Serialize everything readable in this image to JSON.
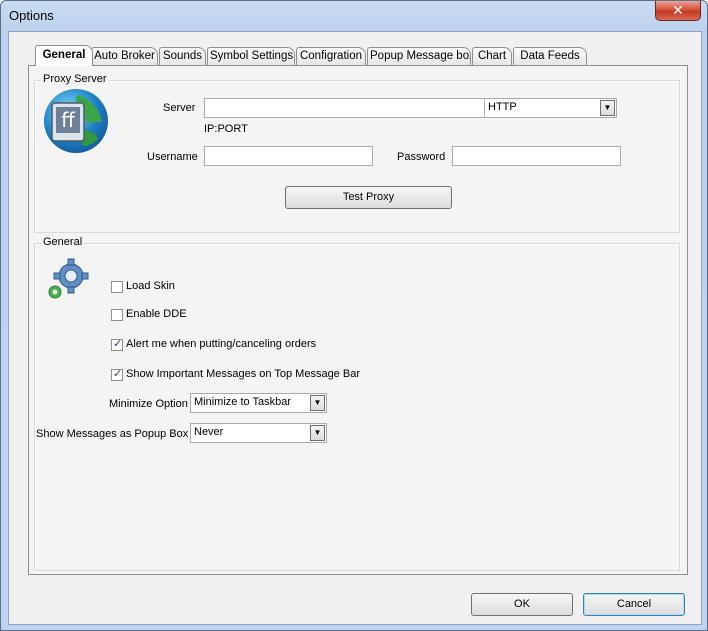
{
  "window": {
    "title": "Options",
    "close_label": "✕"
  },
  "tabs": [
    {
      "label": "General",
      "active": true
    },
    {
      "label": "Auto Broker"
    },
    {
      "label": "Sounds"
    },
    {
      "label": "Symbol Settings"
    },
    {
      "label": "Configration"
    },
    {
      "label": "Popup Message box"
    },
    {
      "label": "Chart"
    },
    {
      "label": "Data Feeds"
    }
  ],
  "proxy": {
    "group_title": "Proxy Server",
    "server_label": "Server",
    "server_value": "",
    "protocol_value": "HTTP",
    "hint": "IP:PORT",
    "username_label": "Username",
    "username_value": "",
    "password_label": "Password",
    "password_value": "",
    "test_button": "Test Proxy"
  },
  "general": {
    "group_title": "General",
    "load_skin": {
      "label": "Load Skin",
      "checked": false
    },
    "enable_dde": {
      "label": "Enable DDE",
      "checked": false
    },
    "alert_orders": {
      "label": "Alert me when putting/canceling orders",
      "checked": true
    },
    "show_top_messages": {
      "label": "Show Important Messages on Top Message Bar",
      "checked": true
    },
    "minimize_label": "Minimize Option",
    "minimize_value": "Minimize to Taskbar",
    "popup_label": "Show Messages as Popup Box",
    "popup_value": "Never"
  },
  "footer": {
    "ok": "OK",
    "cancel": "Cancel"
  },
  "icons": {
    "proxy": "globe-icon",
    "general": "gears-icon",
    "dropdown": "chevron-down-icon"
  }
}
